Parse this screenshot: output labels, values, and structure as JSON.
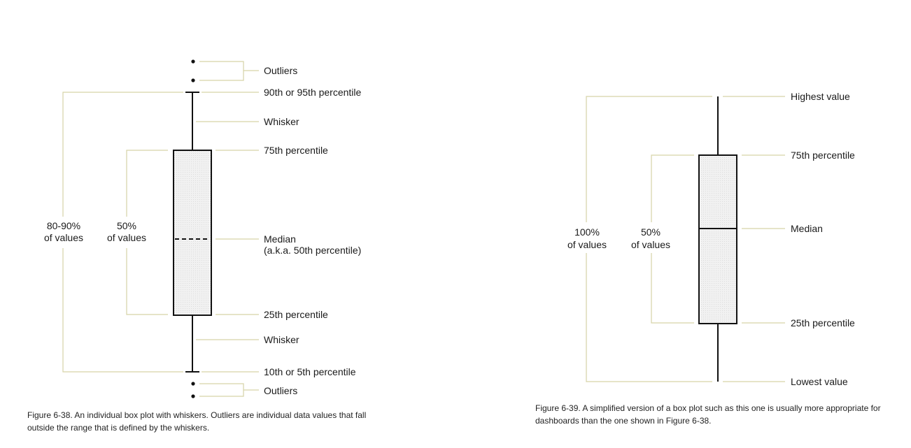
{
  "colors": {
    "leader": "#d6d3a6",
    "box_fill": "#ececec",
    "stroke": "#111111"
  },
  "fig1": {
    "labels": {
      "outliers_top": "Outliers",
      "upper_pct": "90th or 95th percentile",
      "whisker_top": "Whisker",
      "q3": "75th percentile",
      "median_1": "Median",
      "median_2": "(a.k.a. 50th percentile)",
      "q1": "25th percentile",
      "whisker_bottom": "Whisker",
      "lower_pct": "10th or 5th percentile",
      "outliers_bottom": "Outliers"
    },
    "brackets": {
      "outer_1": "80-90%",
      "outer_2": "of values",
      "inner_1": "50%",
      "inner_2": "of values"
    },
    "caption": "Figure 6-38. An individual box plot with whiskers. Outliers are individual data values that fall outside the range that is defined by the whiskers."
  },
  "fig2": {
    "labels": {
      "highest": "Highest value",
      "q3": "75th percentile",
      "median": "Median",
      "q1": "25th percentile",
      "lowest": "Lowest value"
    },
    "brackets": {
      "outer_1": "100%",
      "outer_2": "of values",
      "inner_1": "50%",
      "inner_2": "of values"
    },
    "caption": "Figure 6-39. A simplified version of a box plot such as this one is usually more appropriate for dashboards than the one shown in Figure 6-38."
  }
}
